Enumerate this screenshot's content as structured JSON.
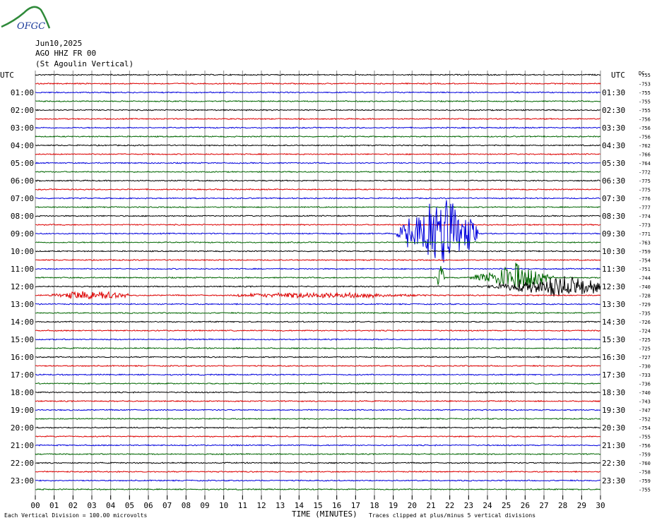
{
  "logo": {
    "text": "OFGC",
    "color": "#2f8a3a",
    "text_color": "#1a3a9a"
  },
  "header": {
    "date": "Jun10,2025",
    "station": "AGO HHZ FR 00",
    "name": "(St Agoulin Vertical)"
  },
  "footer": {
    "left": "Each Vertical Division =  100.00 microvolts",
    "xlabel": "TIME (MINUTES)",
    "right": "Traces clipped at plus/minus 5 vertical divisions"
  },
  "chart_data": {
    "type": "helicorder",
    "left_axis_label": "UTC",
    "right_axis_label": "UTC",
    "dc_label": "DC",
    "trace_colors": [
      "#000000",
      "#dd0000",
      "#0000dd",
      "#006600"
    ],
    "left_hour_labels": [
      "",
      "01:00",
      "02:00",
      "03:00",
      "04:00",
      "05:00",
      "06:00",
      "07:00",
      "08:00",
      "09:00",
      "10:00",
      "11:00",
      "12:00",
      "13:00",
      "14:00",
      "15:00",
      "16:00",
      "17:00",
      "18:00",
      "19:00",
      "20:00",
      "21:00",
      "22:00",
      "23:00"
    ],
    "right_hour_labels": [
      "",
      "01:30",
      "02:30",
      "03:30",
      "04:30",
      "05:30",
      "06:30",
      "07:30",
      "08:30",
      "09:30",
      "10:30",
      "11:30",
      "12:30",
      "13:30",
      "14:30",
      "15:30",
      "16:30",
      "17:30",
      "18:30",
      "19:30",
      "20:30",
      "21:30",
      "22:30",
      "23:30"
    ],
    "dc_offsets": [
      -755,
      -753,
      -755,
      -755,
      -755,
      -756,
      -756,
      -756,
      -762,
      -766,
      -764,
      -772,
      -775,
      -775,
      -776,
      -777,
      -774,
      -773,
      -771,
      -763,
      -759,
      -754,
      -751,
      -744,
      -740,
      -728,
      -729,
      -735,
      -726,
      -724,
      -725,
      -725,
      -727,
      -730,
      -733,
      -736,
      -740,
      -743,
      -747,
      -752,
      -754,
      -755,
      -756,
      -759,
      -760,
      -758,
      -759,
      -755
    ],
    "x_ticks": [
      "00",
      "01",
      "02",
      "03",
      "04",
      "05",
      "06",
      "07",
      "08",
      "09",
      "10",
      "11",
      "12",
      "13",
      "14",
      "15",
      "16",
      "17",
      "18",
      "19",
      "20",
      "21",
      "22",
      "23",
      "24",
      "25",
      "26",
      "27",
      "28",
      "29",
      "30"
    ],
    "x_range": [
      0,
      30
    ],
    "events": [
      {
        "trace": 18,
        "start_min": 19.0,
        "end_min": 23.5,
        "peak_min": 21.5,
        "amplitude": 5
      },
      {
        "trace": 23,
        "start_min": 21.3,
        "end_min": 21.8,
        "peak_min": 21.5,
        "amplitude": 1.6
      },
      {
        "trace": 23,
        "start_min": 23.0,
        "end_min": 27.5,
        "peak_min": 25.5,
        "amplitude": 1.7
      },
      {
        "trace": 24,
        "start_min": 22.3,
        "end_min": 30.0,
        "peak_min": 28.0,
        "amplitude": 1.2
      },
      {
        "trace": 25,
        "start_min": 0.8,
        "end_min": 5.0,
        "peak_min": 3.0,
        "amplitude": 0.6
      },
      {
        "trace": 25,
        "start_min": 10.5,
        "end_min": 21.5,
        "peak_min": 15.0,
        "amplitude": 0.3
      }
    ]
  }
}
